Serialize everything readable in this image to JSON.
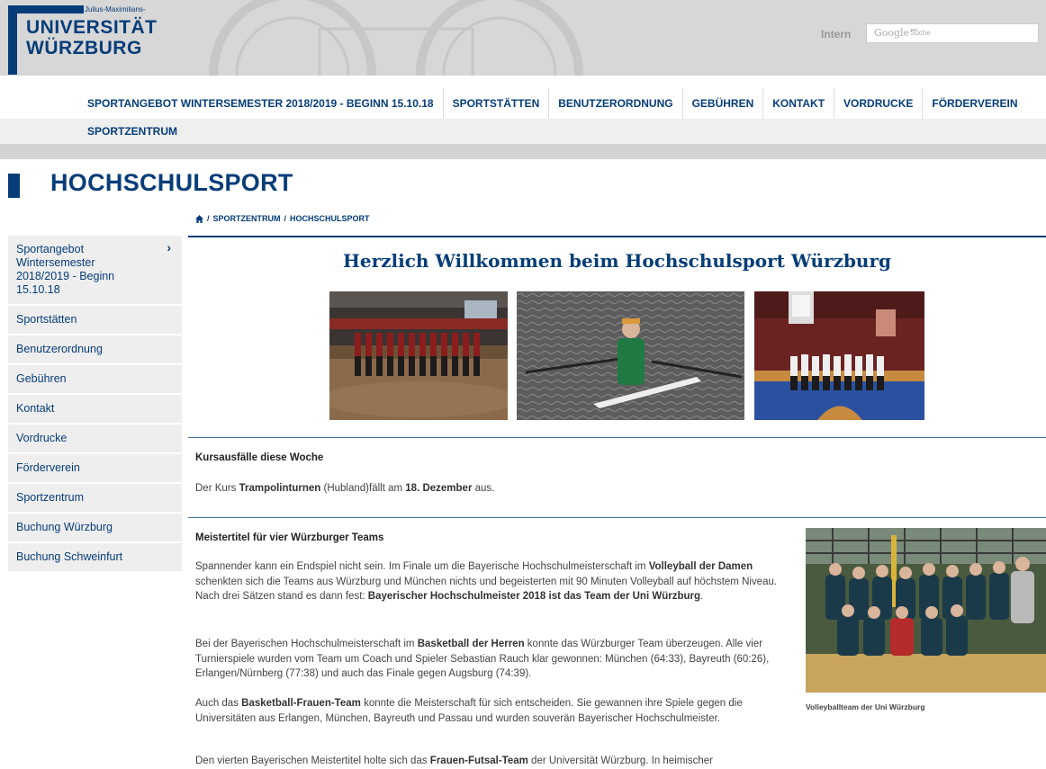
{
  "header": {
    "logo_sub": "Julius-Maximilians-",
    "logo_line1": "UNIVERSITÄT",
    "logo_line2": "WÜRZBURG",
    "intern_label": "Intern",
    "search_brand": "Google™",
    "search_placeholder": "Suche"
  },
  "topnav": {
    "items": [
      "SPORTANGEBOT WINTERSEMESTER 2018/2019 - BEGINN 15.10.18",
      "SPORTSTÄTTEN",
      "BENUTZERORDNUNG",
      "GEBÜHREN",
      "KONTAKT",
      "VORDRUCKE",
      "FÖRDERVEREIN"
    ],
    "row2_item": "SPORTZENTRUM"
  },
  "page_title": "HOCHSCHULSPORT",
  "breadcrumb": {
    "home_icon": "home-icon",
    "sep": "/",
    "items": [
      "SPORTZENTRUM",
      "HOCHSCHULSPORT"
    ]
  },
  "sidebar": {
    "items": [
      "Sportangebot Wintersemester 2018/2019 - Beginn 15.10.18",
      "Sportstätten",
      "Benutzerordnung",
      "Gebühren",
      "Kontakt",
      "Vordrucke",
      "Förderverein",
      "Sportzentrum",
      "Buchung Würzburg",
      "Buchung Schweinfurt"
    ],
    "chevron": "›"
  },
  "main": {
    "welcome": "Herzlich Willkommen beim Hochschulsport Würzburg",
    "kurs_heading": "Kursausfälle diese Woche",
    "kurs_text": {
      "a": "Der Kurs ",
      "b": "Trampolinturnen",
      "c": " (Hubland)fällt am ",
      "d": "18. Dezember",
      "e": " aus."
    },
    "meister_heading": "Meistertitel für vier Würzburger Teams",
    "p1": {
      "a": "Spannender kann ein Endspiel nicht sein. Im Finale um die Bayerische Hochschulmeisterschaft im ",
      "b": "Volleyball der Damen",
      "c": " schenkten sich die Teams aus Würzburg und München nichts und begeisterten mit 90 Minuten Volleyball auf höchstem Niveau. Nach drei Sätzen stand es dann fest: ",
      "d": "Bayerischer Hochschulmeister 2018 ist das Team der Uni Würzburg",
      "e": "."
    },
    "p2": {
      "a": "Bei der Bayerischen Hochschulmeisterschaft im ",
      "b": "Basketball der Herren",
      "c": " konnte das Würzburger Team überzeugen.  Alle vier Turnierspiele wurden vom Team um Coach und Spieler Sebastian Rauch klar gewonnen: München (64:33), Bayreuth (60:26), Erlangen/Nürnberg (77:38) und auch das Finale gegen Augsburg (74:39)."
    },
    "p3": {
      "a": "Auch das ",
      "b": "Basketball-Frauen-Team",
      "c": " konnte die Meisterschaft für sich entscheiden. Sie gewannen ihre Spiele gegen die Universitäten aus Erlangen, München, Bayreuth und Passau und wurden souverän Bayerischer Hochschulmeister."
    },
    "p4": {
      "a": "Den vierten  Bayerischen Meistertitel holte sich das ",
      "b": "Frauen-Futsal-Team",
      "c": " der Universität Würzburg. In heimischer"
    },
    "caption": "Volleyballteam der Uni Würzburg"
  },
  "colors": {
    "brand": "#063d79",
    "nav_bg": "#efefef",
    "header_bg": "#d7d7d7"
  }
}
